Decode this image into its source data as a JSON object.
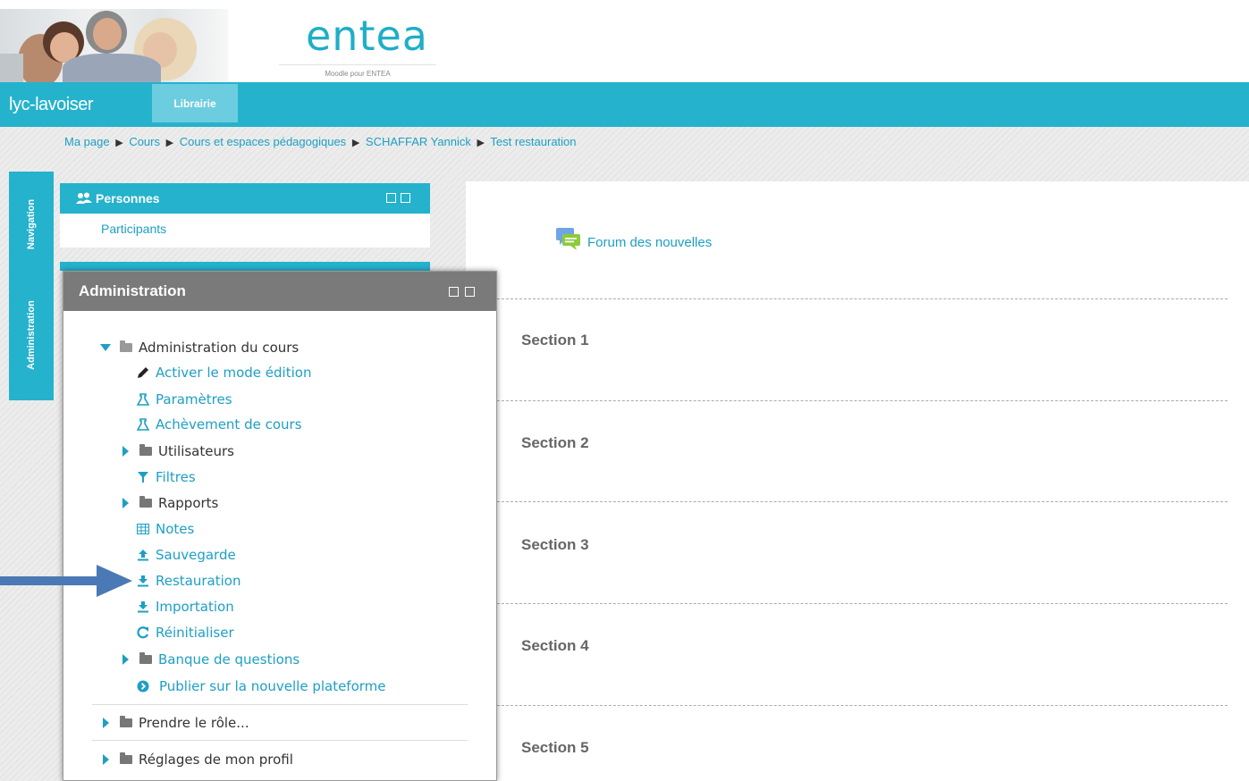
{
  "header": {
    "logo_text": "entea",
    "logo_subtitle": "Moodle pour ENTEA"
  },
  "topbar": {
    "site_name": "lyc-lavoiser",
    "tab_label": "Librairie"
  },
  "breadcrumb": [
    "Ma page",
    "Cours",
    "Cours et espaces pédagogiques",
    "SCHAFFAR Yannick",
    "Test restauration"
  ],
  "breadcrumb_separator": "▶",
  "dock": {
    "navigation": "Navigation",
    "administration": "Administration"
  },
  "personnes_block": {
    "title": "Personnes",
    "participants": "Participants"
  },
  "main": {
    "forum_link": "Forum des nouvelles",
    "sections": [
      "Section 1",
      "Section 2",
      "Section 3",
      "Section 4",
      "Section 5"
    ]
  },
  "admin_panel": {
    "title": "Administration",
    "course_admin": "Administration du cours",
    "items": {
      "edit_mode": "Activer le mode édition",
      "parametres": "Paramètres",
      "achevement": "Achèvement de cours",
      "utilisateurs": "Utilisateurs",
      "filtres": "Filtres",
      "rapports": "Rapports",
      "notes": "Notes",
      "sauvegarde": "Sauvegarde",
      "restauration": "Restauration",
      "importation": "Importation",
      "reinitialiser": "Réinitialiser",
      "banque": "Banque de questions",
      "publier": "Publier sur la nouvelle plateforme"
    },
    "prendre_role": "Prendre le rôle...",
    "reglages_profil": "Réglages de mon profil"
  },
  "colors": {
    "brand": "#25b2cc",
    "link": "#1d9fc4",
    "admin_header": "#7a7a7a",
    "annotation_arrow": "#4a79b5"
  },
  "icons": {
    "personnes": "users-icon",
    "forum": "forum-chat-icon",
    "edit": "pencil-icon",
    "parametres": "flask-icon",
    "achevement": "flask-icon",
    "folder": "folder-icon",
    "filtres": "filter-icon",
    "notes": "table-icon",
    "sauvegarde": "upload-icon",
    "restauration": "download-icon",
    "importation": "download-icon",
    "reinitialiser": "refresh-icon",
    "publier": "chevron-circle-icon"
  }
}
